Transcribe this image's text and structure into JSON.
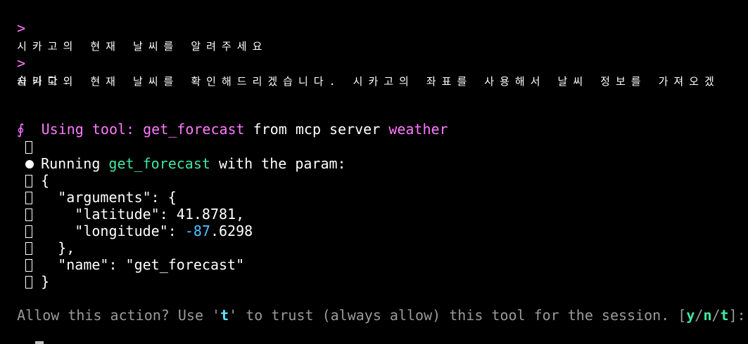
{
  "prompt_symbol": ">",
  "user_query": "시카고의 현재 날씨를 알려주세요",
  "assistant_line1": "시카고의 현재 날씨를 확인해드리겠습니다. 시카고의 좌표를 사용해서 날씨 정보를 가져오겠",
  "assistant_line2": "습니다.",
  "tool_call": {
    "icon_glyph": "∮",
    "prefix": "Using tool: ",
    "tool_name": "get_forecast",
    "middle": " from mcp server ",
    "server_name": "weather"
  },
  "running": {
    "prefix": "Running ",
    "tool_name": "get_forecast",
    "suffix": " with the param:"
  },
  "json_lines": [
    " {",
    "   \"arguments\": {",
    "     \"latitude\": 41.8781,",
    "     \"longitude\": ",
    "   },",
    "   \"name\": \"get_forecast\"",
    " }"
  ],
  "longitude_neg": "-87",
  "longitude_rest": ".6298",
  "confirm": {
    "text_a": "Allow this action? Use '",
    "t_key": "t",
    "text_b": "' to trust (always allow) this tool for the session. [",
    "y_key": "y",
    "sep1": "/",
    "n_key": "n",
    "sep2": "/",
    "t_key2": "t",
    "text_c": "]:"
  },
  "colors": {
    "accent_magenta": "#ff79ff",
    "accent_green": "#42e6a4",
    "muted_grey": "#9a9a9a",
    "number_blue": "#4fc3ff"
  }
}
